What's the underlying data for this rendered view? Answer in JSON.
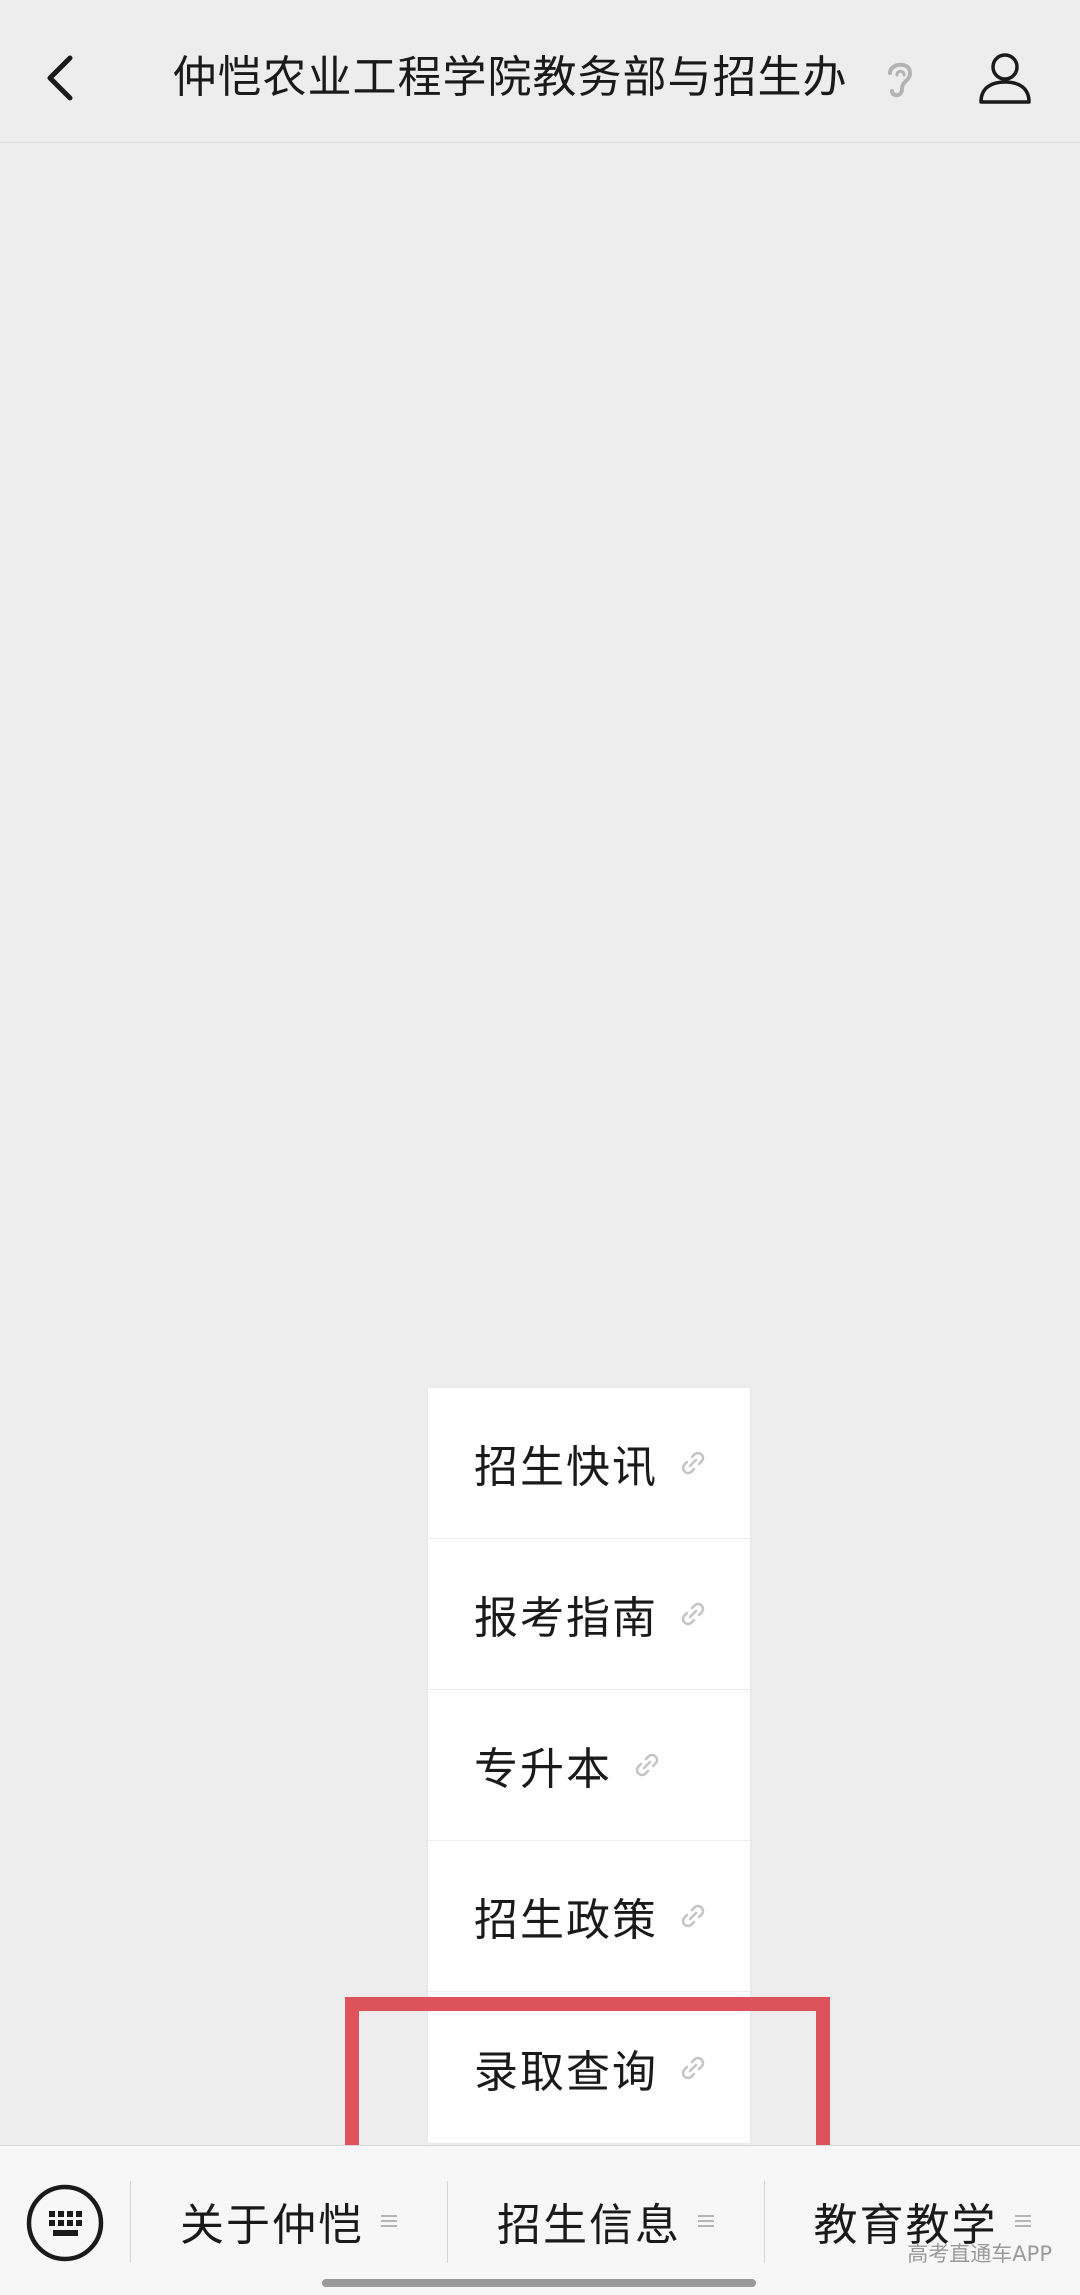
{
  "header": {
    "title": "仲恺农业工程学院教务部与招生办"
  },
  "popup_menu": {
    "items": [
      {
        "label": "招生快讯",
        "icon": "link-icon"
      },
      {
        "label": "报考指南",
        "icon": "link-icon"
      },
      {
        "label": "专升本",
        "icon": "link-icon"
      },
      {
        "label": "招生政策",
        "icon": "link-icon"
      },
      {
        "label": "录取查询",
        "icon": "link-icon",
        "highlighted": true
      }
    ]
  },
  "bottom_bar": {
    "tabs": [
      {
        "label": "关于仲恺",
        "icon": "menu-lines-icon"
      },
      {
        "label": "招生信息",
        "icon": "menu-lines-icon"
      },
      {
        "label": "教育教学",
        "icon": "menu-lines-icon"
      }
    ],
    "watermark": "高考直通车APP"
  },
  "colors": {
    "background": "#ededed",
    "highlight": "#de535b",
    "menu_background": "#ffffff"
  }
}
